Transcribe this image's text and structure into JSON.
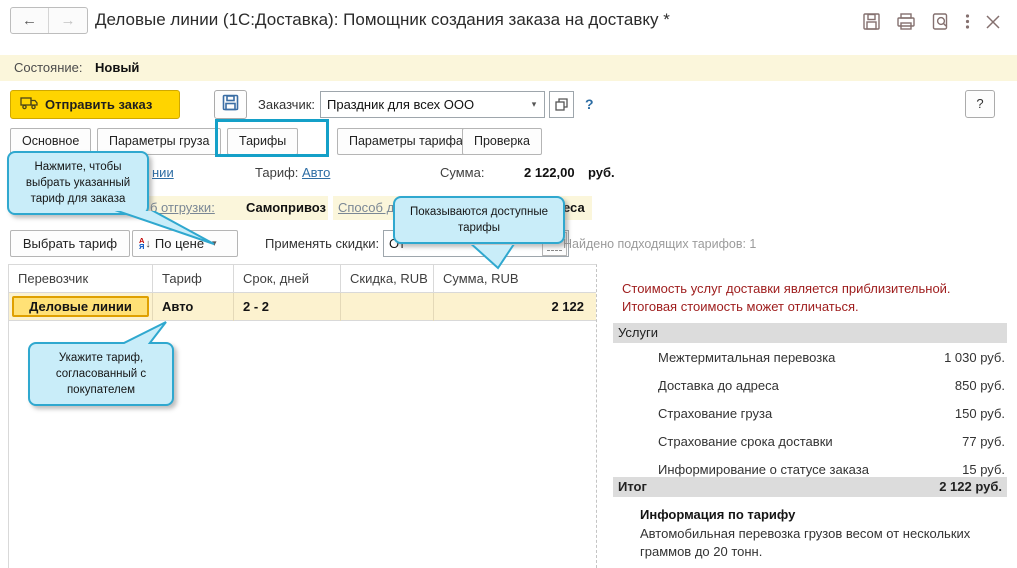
{
  "window": {
    "title": "Деловые линии (1С:Доставка): Помощник создания заказа на доставку *"
  },
  "icons": {
    "back": "←",
    "forward": "→",
    "dropdown": "▾",
    "sort_letter_top": "А",
    "sort_letter_bottom": "Я",
    "sort_arrow": "↓"
  },
  "status_bar": {
    "label": "Состояние:",
    "value": "Новый"
  },
  "toolbar": {
    "send_button": "Отправить заказ",
    "customer_label": "Заказчик:",
    "customer_value": "Праздник для всех ООО",
    "help_link": "?",
    "help_button": "?"
  },
  "tabs": [
    {
      "label": "Основное",
      "highlighted": false
    },
    {
      "label": "Параметры груза",
      "highlighted": false
    },
    {
      "label": "Тарифы",
      "highlighted": true
    },
    {
      "label": "Параметры тарифа",
      "highlighted": false
    },
    {
      "label": "Проверка",
      "highlighted": false
    }
  ],
  "summary_row": {
    "carrier_link_fragment": "нии",
    "tariff_label": "Тариф:",
    "tariff_value": "Авто",
    "sum_label": "Сумма:",
    "sum_value": "2 122,00",
    "sum_currency": "руб."
  },
  "shipping_row": {
    "shipment_link_fragment": "б отгрузки:",
    "shipment_value": "Самопривоз",
    "delivery_link_fragment": "Способ д",
    "delivery_value_fragment": "еса"
  },
  "actions_row": {
    "select_tariff_button": "Выбрать тариф",
    "sort_button": "По цене",
    "apply_discounts_label": "Применять скидки:",
    "apply_discounts_fragment": "От",
    "found_label": "Найдено подходящих тарифов: 1"
  },
  "tariffs_table": {
    "columns": [
      "Перевозчик",
      "Тариф",
      "Срок, дней",
      "Скидка, RUB",
      "Сумма, RUB"
    ],
    "rows": [
      {
        "carrier": "Деловые линии",
        "tariff": "Авто",
        "days": "2 - 2",
        "discount": "",
        "sum": "2 122"
      }
    ]
  },
  "details_panel": {
    "warning_line1": "Стоимость услуг доставки является приблизительной.",
    "warning_line2": "Итоговая стоимость может отличаться.",
    "services_header": "Услуги",
    "services": [
      {
        "name": "Межтермитальная перевозка",
        "price": "1 030 руб."
      },
      {
        "name": "Доставка до адреса",
        "price": "850 руб."
      },
      {
        "name": "Страхование груза",
        "price": "150 руб."
      },
      {
        "name": "Страхование срока доставки",
        "price": "77 руб."
      },
      {
        "name": "Информирование о статусе заказа",
        "price": "15 руб."
      }
    ],
    "total_label": "Итог",
    "total_value": "2 122 руб.",
    "tariff_info_header": "Информация по тарифу",
    "tariff_info_text": "Автомобильная перевозка грузов весом от нескольких граммов до 20 тонн."
  },
  "callouts": [
    {
      "text": "Нажмите, чтобы выбрать указанный тариф для заказа"
    },
    {
      "text": "Показываются доступные тарифы"
    },
    {
      "text": "Укажите тариф, согласованный с покупателем"
    }
  ],
  "colors": {
    "accent_yellow": "#ffd400",
    "highlight_teal": "#14a0c8",
    "callout_bg": "#c9edf9",
    "callout_border": "#2fa8cf",
    "warning_red": "#9e1c1c",
    "link_blue": "#2d6da4",
    "row_yellow": "#fcf2cf",
    "strip_yellow": "#fbf6db"
  }
}
